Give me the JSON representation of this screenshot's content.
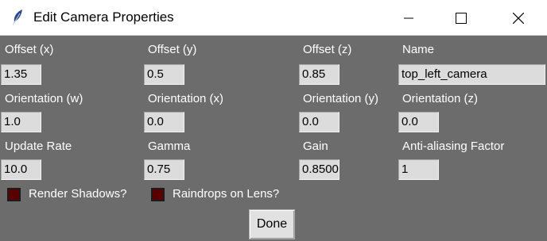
{
  "window": {
    "title": "Edit Camera Properties"
  },
  "rows": [
    {
      "labels": [
        "Offset (x)",
        "Offset (y)",
        "Offset (z)",
        "Name"
      ],
      "values": [
        "1.35",
        "0.5",
        "0.85",
        "top_left_camera"
      ]
    },
    {
      "labels": [
        "Orientation (w)",
        "Orientation (x)",
        "Orientation (y)",
        "Orientation (z)"
      ],
      "values": [
        "1.0",
        "0.0",
        "0.0",
        "0.0"
      ]
    },
    {
      "labels": [
        "Update Rate",
        "Gamma",
        "Gain",
        "Anti-aliasing Factor"
      ],
      "values": [
        "10.0",
        "0.75",
        "0.8500",
        "1"
      ]
    }
  ],
  "checkboxes": [
    {
      "label": "Render Shadows?"
    },
    {
      "label": "Raindrops on Lens?"
    }
  ],
  "done_label": "Done",
  "colors": {
    "background": "#6c6c6c",
    "checkbox_fill": "#5a0000",
    "field_bg": "#dcdcdc"
  }
}
